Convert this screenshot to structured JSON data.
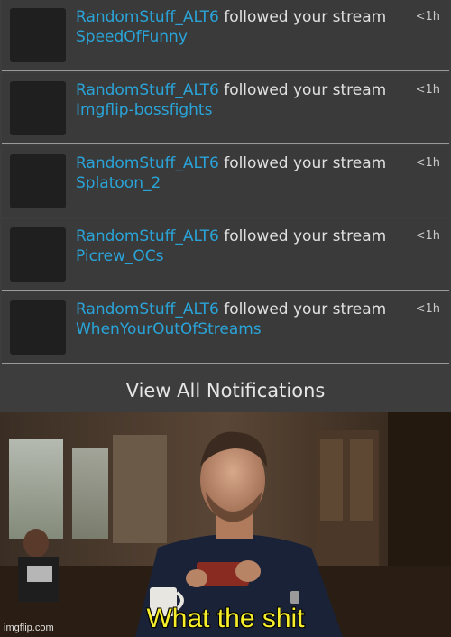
{
  "notifications": [
    {
      "user": "RandomStuff_ALT6",
      "action": "followed your stream",
      "stream": "SpeedOfFunny",
      "time": "<1h"
    },
    {
      "user": "RandomStuff_ALT6",
      "action": "followed your stream",
      "stream": "Imgflip-bossfights",
      "time": "<1h"
    },
    {
      "user": "RandomStuff_ALT6",
      "action": "followed your stream",
      "stream": "Splatoon_2",
      "time": "<1h"
    },
    {
      "user": "RandomStuff_ALT6",
      "action": "followed your stream",
      "stream": "Picrew_OCs",
      "time": "<1h"
    },
    {
      "user": "RandomStuff_ALT6",
      "action": "followed your stream",
      "stream": "WhenYourOutOfStreams",
      "time": "<1h"
    }
  ],
  "view_all_label": "View All Notifications",
  "meme": {
    "caption": "What the shit",
    "watermark": "imgflip.com"
  },
  "colors": {
    "link": "#2aa4d8",
    "caption": "#f6ee2a"
  }
}
